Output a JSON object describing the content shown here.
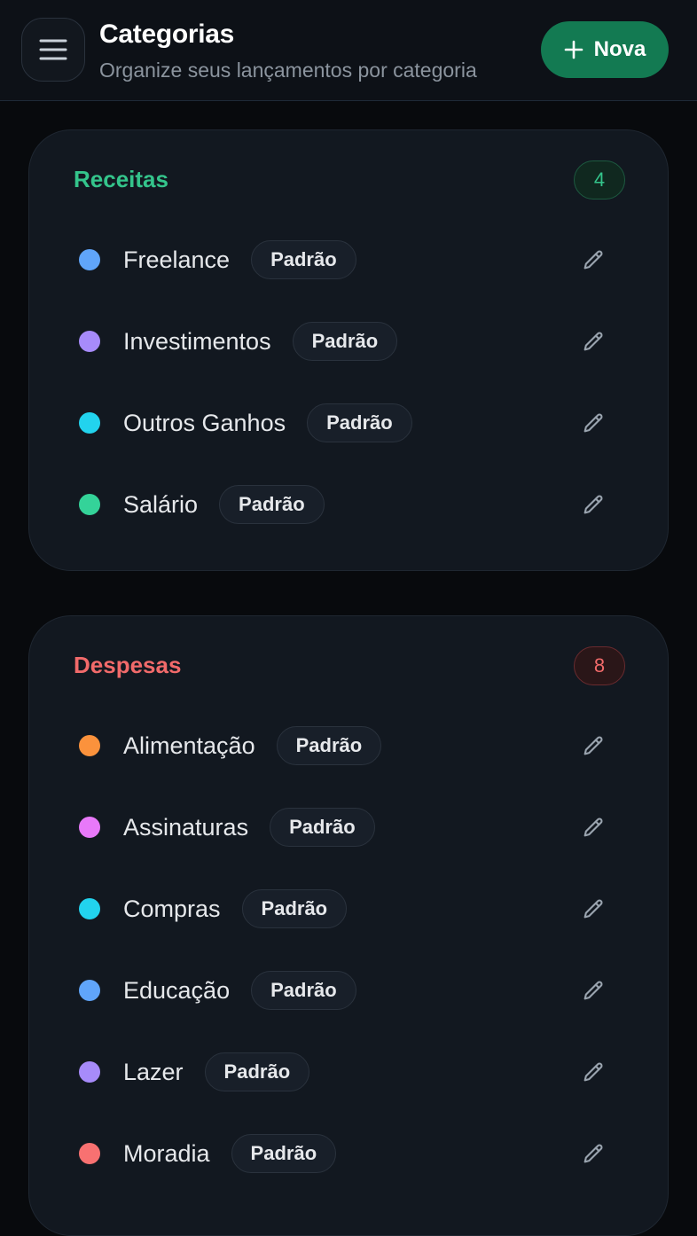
{
  "header": {
    "title": "Categorias",
    "subtitle": "Organize seus lançamentos por categoria",
    "new_button_label": "Nova",
    "menu_icon": "hamburger-menu-icon",
    "new_icon": "plus-icon"
  },
  "colors": {
    "background": "#080a0d",
    "header_bg": "#0d1117",
    "card_bg": "#121820",
    "primary_green": "#137a52",
    "income_accent": "#34c48b",
    "expense_accent": "#f16a6a"
  },
  "sections": [
    {
      "title": "Receitas",
      "count": "4",
      "accent": "#34c48b",
      "items": [
        {
          "name": "Freelance",
          "tag": "Padrão",
          "color": "#60a5fa"
        },
        {
          "name": "Investimentos",
          "tag": "Padrão",
          "color": "#a78bfa"
        },
        {
          "name": "Outros Ganhos",
          "tag": "Padrão",
          "color": "#22d3ee"
        },
        {
          "name": "Salário",
          "tag": "Padrão",
          "color": "#34d399"
        }
      ]
    },
    {
      "title": "Despesas",
      "count": "8",
      "accent": "#f16a6a",
      "items": [
        {
          "name": "Alimentação",
          "tag": "Padrão",
          "color": "#fb923c"
        },
        {
          "name": "Assinaturas",
          "tag": "Padrão",
          "color": "#e879f9"
        },
        {
          "name": "Compras",
          "tag": "Padrão",
          "color": "#22d3ee"
        },
        {
          "name": "Educação",
          "tag": "Padrão",
          "color": "#60a5fa"
        },
        {
          "name": "Lazer",
          "tag": "Padrão",
          "color": "#a78bfa"
        },
        {
          "name": "Moradia",
          "tag": "Padrão",
          "color": "#f87171"
        }
      ]
    }
  ]
}
